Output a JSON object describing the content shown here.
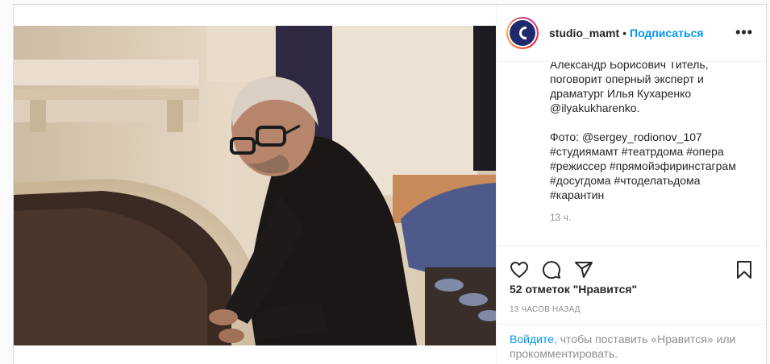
{
  "header": {
    "username": "studio_mamt",
    "separator": "•",
    "follow_label": "Подписаться",
    "more_label": "•••"
  },
  "caption": {
    "text": "Александр Борисович Титель, поговорит оперный эксперт и драматург Илья Кухаренко @ilyakukharenko.\n\nФото: @sergey_rodionov_107\n#студиямамт #театрдома #опера #режиссер #прямойэфиринстаграм #досугдома #чтоделатьдома #карантин",
    "time": "13 ч."
  },
  "actions": {
    "likes": "52 отметок \"Нравится\"",
    "post_time": "13 ЧАСОВ НАЗАД"
  },
  "login": {
    "link": "Войдите",
    "text": ", чтобы поставить «Нравится» или прокомментировать."
  },
  "colors": {
    "accent": "#0095f6",
    "text": "#262626",
    "muted": "#8e8e8e",
    "avatar_bg": "#1f2a6e"
  }
}
